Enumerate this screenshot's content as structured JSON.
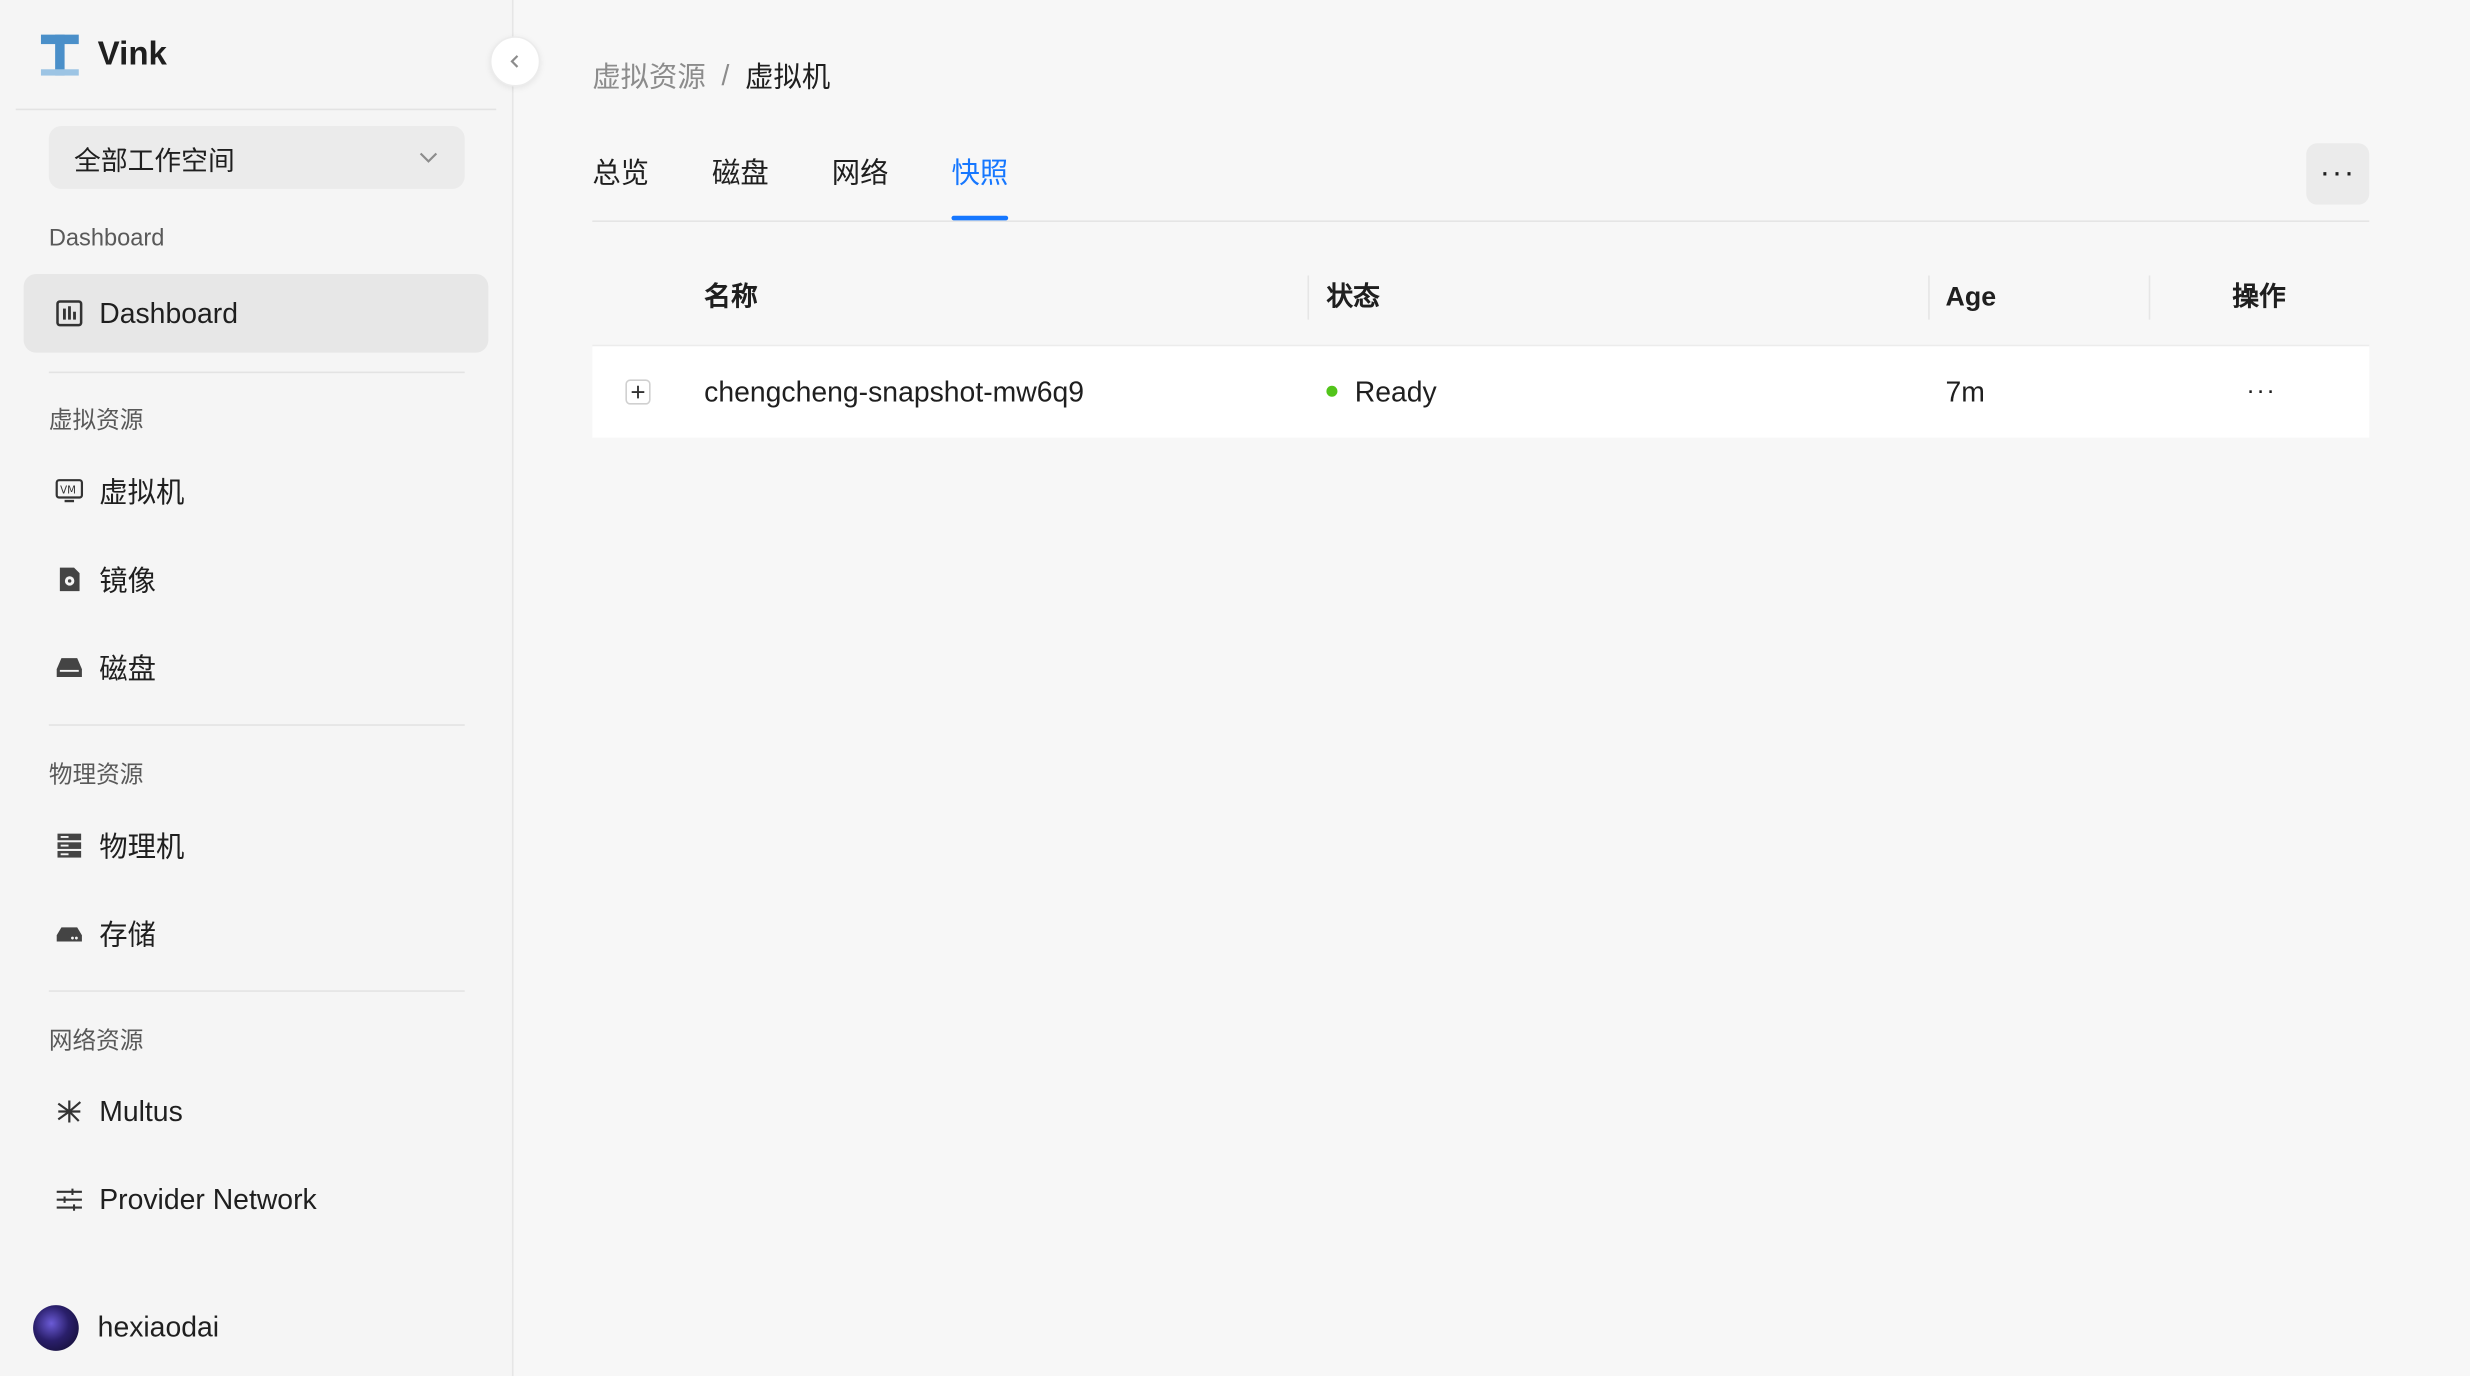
{
  "app": {
    "name": "Vink"
  },
  "sidebar": {
    "workspace": "全部工作空间",
    "sections": [
      {
        "label": "Dashboard",
        "items": [
          {
            "label": "Dashboard",
            "icon": "dashboard-icon",
            "active": true
          }
        ]
      },
      {
        "label": "虚拟资源",
        "items": [
          {
            "label": "虚拟机",
            "icon": "vm-icon"
          },
          {
            "label": "镜像",
            "icon": "image-icon"
          },
          {
            "label": "磁盘",
            "icon": "disk-icon"
          }
        ]
      },
      {
        "label": "物理资源",
        "items": [
          {
            "label": "物理机",
            "icon": "server-icon"
          },
          {
            "label": "存储",
            "icon": "storage-icon"
          }
        ]
      },
      {
        "label": "网络资源",
        "items": [
          {
            "label": "Multus",
            "icon": "multus-icon"
          },
          {
            "label": "Provider Network",
            "icon": "sliders-icon"
          }
        ]
      }
    ],
    "user": {
      "name": "hexiaodai"
    }
  },
  "breadcrumb": {
    "parent": "虚拟资源",
    "separator": "/",
    "current": "虚拟机"
  },
  "tabs": [
    {
      "label": "总览",
      "active": false
    },
    {
      "label": "磁盘",
      "active": false
    },
    {
      "label": "网络",
      "active": false
    },
    {
      "label": "快照",
      "active": true
    }
  ],
  "more_label": "···",
  "table": {
    "columns": [
      "名称",
      "状态",
      "Age",
      "操作"
    ],
    "rows": [
      {
        "name": "chengcheng-snapshot-mw6q9",
        "status": "Ready",
        "status_color": "#52c41a",
        "age": "7m",
        "action": "···"
      }
    ]
  },
  "colors": {
    "accent": "#1677ff",
    "ready": "#52c41a"
  }
}
